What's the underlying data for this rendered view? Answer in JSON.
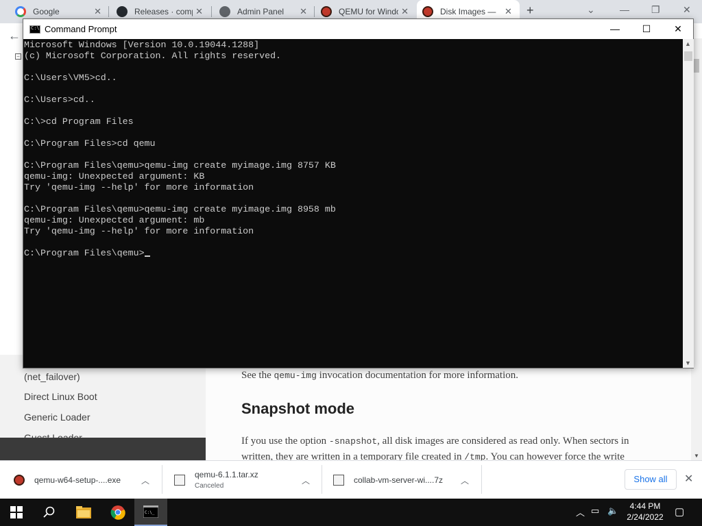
{
  "browser": {
    "tabs": [
      {
        "title": "Google",
        "icon": "google-icon",
        "active": false
      },
      {
        "title": "Releases · comp",
        "icon": "github-icon",
        "active": false
      },
      {
        "title": "Admin Panel",
        "icon": "globe-icon",
        "active": false
      },
      {
        "title": "QEMU for Windo",
        "icon": "qemu-icon",
        "active": false
      },
      {
        "title": "Disk Images —",
        "icon": "qemu-icon",
        "active": true
      }
    ],
    "new_tab_symbol": "+",
    "tab_close_symbol": "✕",
    "back_symbol": "←"
  },
  "cmd": {
    "title": "Command Prompt",
    "minimize": "—",
    "maximize": "☐",
    "close": "✕",
    "lines": [
      "Microsoft Windows [Version 10.0.19044.1288]",
      "(c) Microsoft Corporation. All rights reserved.",
      "",
      "C:\\Users\\VM5>cd..",
      "",
      "C:\\Users>cd..",
      "",
      "C:\\>cd Program Files",
      "",
      "C:\\Program Files>cd qemu",
      "",
      "C:\\Program Files\\qemu>qemu-img create myimage.img 8757 KB",
      "qemu-img: Unexpected argument: KB",
      "Try 'qemu-img --help' for more information",
      "",
      "C:\\Program Files\\qemu>qemu-img create myimage.img 8958 mb",
      "qemu-img: Unexpected argument: mb",
      "Try 'qemu-img --help' for more information",
      ""
    ],
    "prompt": "C:\\Program Files\\qemu>",
    "colors": {
      "background": "#0c0c0c",
      "text": "#cccccc"
    }
  },
  "sidebar": {
    "items": [
      "(net_failover)",
      "Direct Linux Boot",
      "Generic Loader",
      "Guest Loader"
    ]
  },
  "content": {
    "see_prefix": "See the ",
    "see_code": "qemu-img",
    "see_suffix": " invocation documentation for more information.",
    "heading": "Snapshot mode",
    "p1_prefix": "If you use the option ",
    "p1_code": "-snapshot",
    "p1_suffix": ", all disk images are considered as read only. When sectors in",
    "p2_prefix": "written, they are written in a temporary file created in ",
    "p2_code": "/tmp",
    "p2_suffix": ". You can however force the write"
  },
  "downloads": {
    "items": [
      {
        "name": "qemu-w64-setup-....exe",
        "status": "",
        "icon": "qemu-icon"
      },
      {
        "name": "qemu-6.1.1.tar.xz",
        "status": "Canceled",
        "icon": "archive-icon"
      },
      {
        "name": "collab-vm-server-wi....7z",
        "status": "",
        "icon": "archive-icon"
      }
    ],
    "show_all": "Show all",
    "close": "✕"
  },
  "taskbar": {
    "time": "4:44 PM",
    "date": "2/24/2022",
    "apps": [
      "start-icon",
      "search-icon",
      "file-explorer-icon",
      "chrome-icon",
      "command-prompt-icon"
    ],
    "accent": "#8aa6d8"
  }
}
